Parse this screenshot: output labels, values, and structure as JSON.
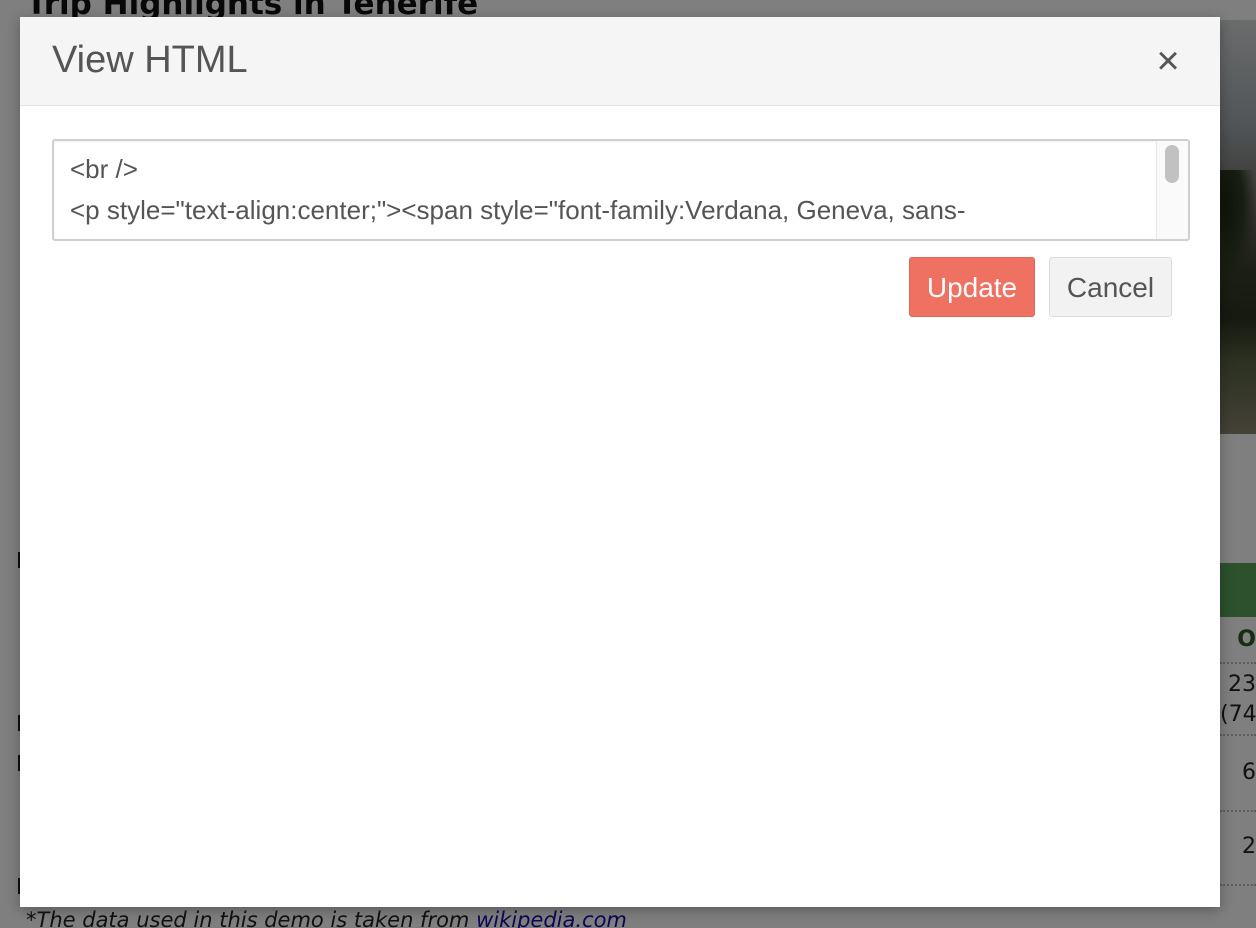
{
  "background_page": {
    "title": "Trip Highlights in Tenerife",
    "table_header_cell": "O",
    "table_rows": [
      "23 (74",
      "6",
      "2"
    ],
    "footnote_prefix": "*The data used in this demo is taken from ",
    "footnote_link": "wikipedia.com"
  },
  "modal": {
    "title": "View HTML",
    "close_symbol": "×",
    "code_lines": [
      "<br />",
      "<p style=\"text-align:center;\"><span style=\"font-family:Verdana, Geneva, sans-"
    ],
    "update_label": "Update",
    "cancel_label": "Cancel"
  },
  "colors": {
    "update_button": "#ee7161",
    "cancel_button": "#f2f2f2",
    "header_background": "#f5f5f5",
    "overlay": "rgba(0,0,0,0.5)",
    "table_header_bar": "#5aa05a"
  }
}
